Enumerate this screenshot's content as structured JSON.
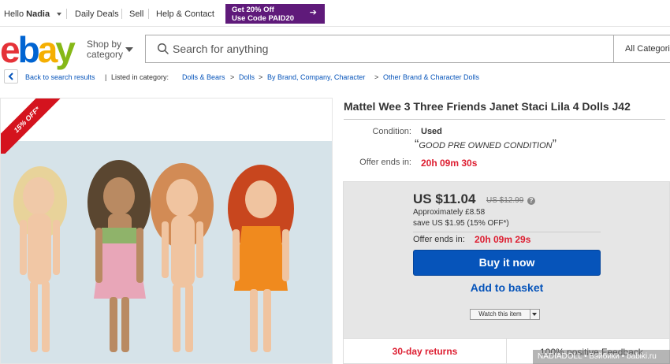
{
  "topbar": {
    "greeting": "Hello",
    "user_name": "Nadia",
    "daily_deals": "Daily Deals",
    "sell": "Sell",
    "help_contact": "Help & Contact",
    "promo_line1": "Get 20% Off",
    "promo_line2": "Use Code PAID20",
    "promo_arrow": "➔"
  },
  "header": {
    "logo_letters": [
      "e",
      "b",
      "a",
      "y"
    ],
    "shop_by_line1": "Shop by",
    "shop_by_line2": "category",
    "search_placeholder": "Search for anything",
    "search_category": "All Categories"
  },
  "breadcrumb": {
    "back_label": "Back to search results",
    "divider": "|",
    "listed_in": "Listed in category:",
    "items": [
      "Dolls & Bears",
      "Dolls",
      "By Brand, Company, Character",
      "Other Brand & Character Dolls"
    ],
    "sep": ">"
  },
  "image": {
    "ribbon": "15% OFF*"
  },
  "listing": {
    "title": "Mattel Wee 3 Three Friends Janet Staci Lila 4 Dolls J42",
    "condition_label": "Condition:",
    "condition_value": "Used",
    "condition_note": "GOOD PRE OWNED CONDITION",
    "quote_open": "“",
    "quote_close": "”",
    "offer_label": "Offer ends in:",
    "offer_time": "20h 09m 30s"
  },
  "pricebox": {
    "price": "US $11.04",
    "was_price": "US $12.99",
    "info_icon": "?",
    "approx": "Approximately £8.58",
    "save": "save US $1.95 (15% OFF*)",
    "offer_label": "Offer ends in:",
    "offer_time": "20h 09m 29s",
    "buy_now": "Buy it now",
    "add_basket": "Add to basket",
    "watch": "Watch this item"
  },
  "bottom": {
    "returns": "30-day returns",
    "feedback": "100% positive Feedback"
  },
  "watermark": "NADIADOLL • Бэйбики • babiki.ru",
  "colors": {
    "ebay_red": "#e53238",
    "ebay_blue": "#0064d2",
    "ebay_yellow": "#f5af02",
    "ebay_green": "#86b817",
    "link_blue": "#0654ba",
    "promo_purple": "#5f1a7a",
    "offer_red": "#dd1e31"
  },
  "icons": [
    "chevron-down-icon",
    "search-icon",
    "chevron-left-icon",
    "arrow-right-icon",
    "info-icon"
  ]
}
